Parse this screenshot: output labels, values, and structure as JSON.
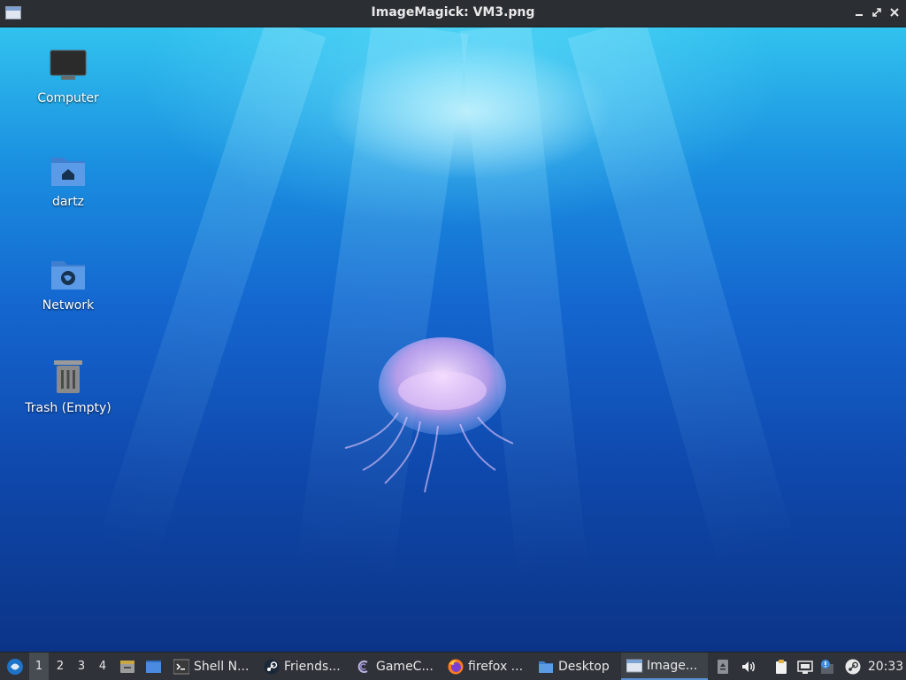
{
  "window": {
    "title": "ImageMagick: VM3.png"
  },
  "desktop_icons": [
    {
      "label": "Computer",
      "icon": "computer-icon"
    },
    {
      "label": "dartz",
      "icon": "home-folder-icon"
    },
    {
      "label": "Network",
      "icon": "network-folder-icon"
    },
    {
      "label": "Trash (Empty)",
      "icon": "trash-icon"
    }
  ],
  "taskbar": {
    "workspaces": [
      "1",
      "2",
      "3",
      "4"
    ],
    "active_workspace": "1",
    "tasks": [
      {
        "label": "Shell N...",
        "icon": "terminal-icon"
      },
      {
        "label": "Friends...",
        "icon": "steam-icon"
      },
      {
        "label": "GameC...",
        "icon": "gamecube-icon"
      },
      {
        "label": "firefox ...",
        "icon": "firefox-icon"
      },
      {
        "label": "Desktop",
        "icon": "folder-icon"
      },
      {
        "label": "Image...",
        "icon": "imagemagick-icon",
        "active": true
      }
    ],
    "clock": "20:33"
  },
  "colors": {
    "accent": "#5a8fd6",
    "taskbar_bg": "#2f3238",
    "titlebar_bg": "#2b2e33"
  }
}
